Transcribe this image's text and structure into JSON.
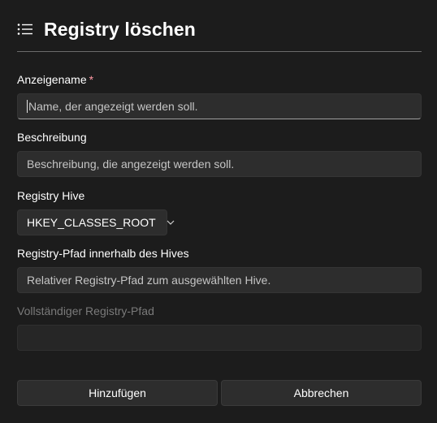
{
  "header": {
    "title": "Registry löschen",
    "icon": "list-icon"
  },
  "form": {
    "display_name": {
      "label": "Anzeigename",
      "required_mark": "*",
      "placeholder": "Name, der angezeigt werden soll."
    },
    "description": {
      "label": "Beschreibung",
      "placeholder": "Beschreibung, die angezeigt werden soll."
    },
    "registry_hive": {
      "label": "Registry Hive",
      "selected": "HKEY_CLASSES_ROOT",
      "icon": "chevron-down-icon"
    },
    "registry_path": {
      "label": "Registry-Pfad innerhalb des Hives",
      "placeholder": "Relativer Registry-Pfad zum ausgewählten Hive."
    },
    "full_path": {
      "label": "Vollständiger Registry-Pfad",
      "value": ""
    }
  },
  "buttons": {
    "add_label": "Hinzufügen",
    "cancel_label": "Abbrechen"
  },
  "colors": {
    "background": "#1c1c1c",
    "field_background": "#2d2d2d",
    "required_mark": "#ff99a4",
    "disabled_text": "#7a7a7a"
  }
}
